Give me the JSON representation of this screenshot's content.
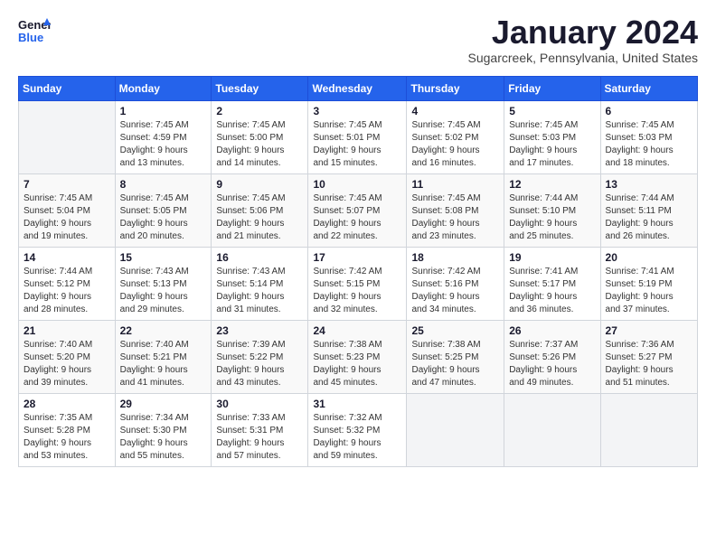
{
  "header": {
    "logo_line1": "General",
    "logo_line2": "Blue",
    "month": "January 2024",
    "location": "Sugarcreek, Pennsylvania, United States"
  },
  "weekdays": [
    "Sunday",
    "Monday",
    "Tuesday",
    "Wednesday",
    "Thursday",
    "Friday",
    "Saturday"
  ],
  "weeks": [
    [
      {
        "day": "",
        "info": ""
      },
      {
        "day": "1",
        "info": "Sunrise: 7:45 AM\nSunset: 4:59 PM\nDaylight: 9 hours\nand 13 minutes."
      },
      {
        "day": "2",
        "info": "Sunrise: 7:45 AM\nSunset: 5:00 PM\nDaylight: 9 hours\nand 14 minutes."
      },
      {
        "day": "3",
        "info": "Sunrise: 7:45 AM\nSunset: 5:01 PM\nDaylight: 9 hours\nand 15 minutes."
      },
      {
        "day": "4",
        "info": "Sunrise: 7:45 AM\nSunset: 5:02 PM\nDaylight: 9 hours\nand 16 minutes."
      },
      {
        "day": "5",
        "info": "Sunrise: 7:45 AM\nSunset: 5:03 PM\nDaylight: 9 hours\nand 17 minutes."
      },
      {
        "day": "6",
        "info": "Sunrise: 7:45 AM\nSunset: 5:03 PM\nDaylight: 9 hours\nand 18 minutes."
      }
    ],
    [
      {
        "day": "7",
        "info": "Sunrise: 7:45 AM\nSunset: 5:04 PM\nDaylight: 9 hours\nand 19 minutes."
      },
      {
        "day": "8",
        "info": "Sunrise: 7:45 AM\nSunset: 5:05 PM\nDaylight: 9 hours\nand 20 minutes."
      },
      {
        "day": "9",
        "info": "Sunrise: 7:45 AM\nSunset: 5:06 PM\nDaylight: 9 hours\nand 21 minutes."
      },
      {
        "day": "10",
        "info": "Sunrise: 7:45 AM\nSunset: 5:07 PM\nDaylight: 9 hours\nand 22 minutes."
      },
      {
        "day": "11",
        "info": "Sunrise: 7:45 AM\nSunset: 5:08 PM\nDaylight: 9 hours\nand 23 minutes."
      },
      {
        "day": "12",
        "info": "Sunrise: 7:44 AM\nSunset: 5:10 PM\nDaylight: 9 hours\nand 25 minutes."
      },
      {
        "day": "13",
        "info": "Sunrise: 7:44 AM\nSunset: 5:11 PM\nDaylight: 9 hours\nand 26 minutes."
      }
    ],
    [
      {
        "day": "14",
        "info": "Sunrise: 7:44 AM\nSunset: 5:12 PM\nDaylight: 9 hours\nand 28 minutes."
      },
      {
        "day": "15",
        "info": "Sunrise: 7:43 AM\nSunset: 5:13 PM\nDaylight: 9 hours\nand 29 minutes."
      },
      {
        "day": "16",
        "info": "Sunrise: 7:43 AM\nSunset: 5:14 PM\nDaylight: 9 hours\nand 31 minutes."
      },
      {
        "day": "17",
        "info": "Sunrise: 7:42 AM\nSunset: 5:15 PM\nDaylight: 9 hours\nand 32 minutes."
      },
      {
        "day": "18",
        "info": "Sunrise: 7:42 AM\nSunset: 5:16 PM\nDaylight: 9 hours\nand 34 minutes."
      },
      {
        "day": "19",
        "info": "Sunrise: 7:41 AM\nSunset: 5:17 PM\nDaylight: 9 hours\nand 36 minutes."
      },
      {
        "day": "20",
        "info": "Sunrise: 7:41 AM\nSunset: 5:19 PM\nDaylight: 9 hours\nand 37 minutes."
      }
    ],
    [
      {
        "day": "21",
        "info": "Sunrise: 7:40 AM\nSunset: 5:20 PM\nDaylight: 9 hours\nand 39 minutes."
      },
      {
        "day": "22",
        "info": "Sunrise: 7:40 AM\nSunset: 5:21 PM\nDaylight: 9 hours\nand 41 minutes."
      },
      {
        "day": "23",
        "info": "Sunrise: 7:39 AM\nSunset: 5:22 PM\nDaylight: 9 hours\nand 43 minutes."
      },
      {
        "day": "24",
        "info": "Sunrise: 7:38 AM\nSunset: 5:23 PM\nDaylight: 9 hours\nand 45 minutes."
      },
      {
        "day": "25",
        "info": "Sunrise: 7:38 AM\nSunset: 5:25 PM\nDaylight: 9 hours\nand 47 minutes."
      },
      {
        "day": "26",
        "info": "Sunrise: 7:37 AM\nSunset: 5:26 PM\nDaylight: 9 hours\nand 49 minutes."
      },
      {
        "day": "27",
        "info": "Sunrise: 7:36 AM\nSunset: 5:27 PM\nDaylight: 9 hours\nand 51 minutes."
      }
    ],
    [
      {
        "day": "28",
        "info": "Sunrise: 7:35 AM\nSunset: 5:28 PM\nDaylight: 9 hours\nand 53 minutes."
      },
      {
        "day": "29",
        "info": "Sunrise: 7:34 AM\nSunset: 5:30 PM\nDaylight: 9 hours\nand 55 minutes."
      },
      {
        "day": "30",
        "info": "Sunrise: 7:33 AM\nSunset: 5:31 PM\nDaylight: 9 hours\nand 57 minutes."
      },
      {
        "day": "31",
        "info": "Sunrise: 7:32 AM\nSunset: 5:32 PM\nDaylight: 9 hours\nand 59 minutes."
      },
      {
        "day": "",
        "info": ""
      },
      {
        "day": "",
        "info": ""
      },
      {
        "day": "",
        "info": ""
      }
    ]
  ]
}
